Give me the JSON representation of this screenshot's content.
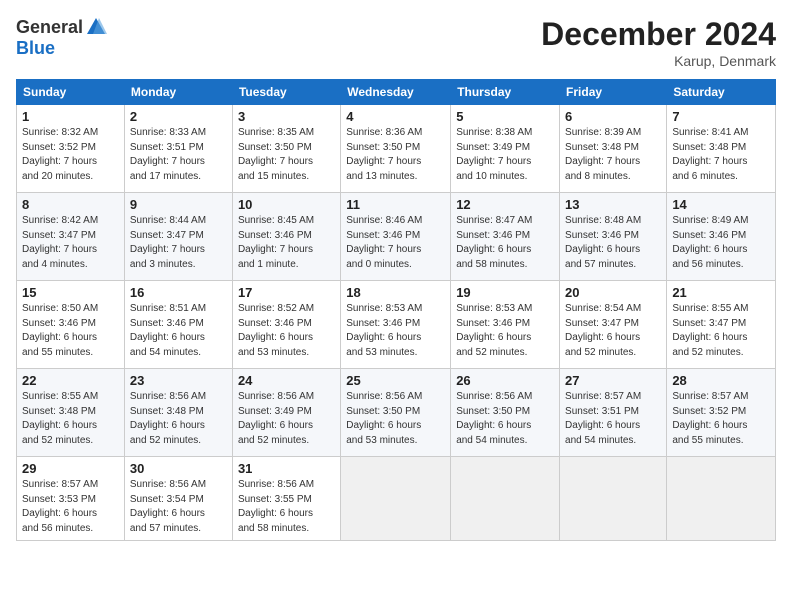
{
  "header": {
    "logo_general": "General",
    "logo_blue": "Blue",
    "month_title": "December 2024",
    "location": "Karup, Denmark"
  },
  "columns": [
    "Sunday",
    "Monday",
    "Tuesday",
    "Wednesday",
    "Thursday",
    "Friday",
    "Saturday"
  ],
  "weeks": [
    [
      {
        "day": "1",
        "info": "Sunrise: 8:32 AM\nSunset: 3:52 PM\nDaylight: 7 hours\nand 20 minutes."
      },
      {
        "day": "2",
        "info": "Sunrise: 8:33 AM\nSunset: 3:51 PM\nDaylight: 7 hours\nand 17 minutes."
      },
      {
        "day": "3",
        "info": "Sunrise: 8:35 AM\nSunset: 3:50 PM\nDaylight: 7 hours\nand 15 minutes."
      },
      {
        "day": "4",
        "info": "Sunrise: 8:36 AM\nSunset: 3:50 PM\nDaylight: 7 hours\nand 13 minutes."
      },
      {
        "day": "5",
        "info": "Sunrise: 8:38 AM\nSunset: 3:49 PM\nDaylight: 7 hours\nand 10 minutes."
      },
      {
        "day": "6",
        "info": "Sunrise: 8:39 AM\nSunset: 3:48 PM\nDaylight: 7 hours\nand 8 minutes."
      },
      {
        "day": "7",
        "info": "Sunrise: 8:41 AM\nSunset: 3:48 PM\nDaylight: 7 hours\nand 6 minutes."
      }
    ],
    [
      {
        "day": "8",
        "info": "Sunrise: 8:42 AM\nSunset: 3:47 PM\nDaylight: 7 hours\nand 4 minutes."
      },
      {
        "day": "9",
        "info": "Sunrise: 8:44 AM\nSunset: 3:47 PM\nDaylight: 7 hours\nand 3 minutes."
      },
      {
        "day": "10",
        "info": "Sunrise: 8:45 AM\nSunset: 3:46 PM\nDaylight: 7 hours\nand 1 minute."
      },
      {
        "day": "11",
        "info": "Sunrise: 8:46 AM\nSunset: 3:46 PM\nDaylight: 7 hours\nand 0 minutes."
      },
      {
        "day": "12",
        "info": "Sunrise: 8:47 AM\nSunset: 3:46 PM\nDaylight: 6 hours\nand 58 minutes."
      },
      {
        "day": "13",
        "info": "Sunrise: 8:48 AM\nSunset: 3:46 PM\nDaylight: 6 hours\nand 57 minutes."
      },
      {
        "day": "14",
        "info": "Sunrise: 8:49 AM\nSunset: 3:46 PM\nDaylight: 6 hours\nand 56 minutes."
      }
    ],
    [
      {
        "day": "15",
        "info": "Sunrise: 8:50 AM\nSunset: 3:46 PM\nDaylight: 6 hours\nand 55 minutes."
      },
      {
        "day": "16",
        "info": "Sunrise: 8:51 AM\nSunset: 3:46 PM\nDaylight: 6 hours\nand 54 minutes."
      },
      {
        "day": "17",
        "info": "Sunrise: 8:52 AM\nSunset: 3:46 PM\nDaylight: 6 hours\nand 53 minutes."
      },
      {
        "day": "18",
        "info": "Sunrise: 8:53 AM\nSunset: 3:46 PM\nDaylight: 6 hours\nand 53 minutes."
      },
      {
        "day": "19",
        "info": "Sunrise: 8:53 AM\nSunset: 3:46 PM\nDaylight: 6 hours\nand 52 minutes."
      },
      {
        "day": "20",
        "info": "Sunrise: 8:54 AM\nSunset: 3:47 PM\nDaylight: 6 hours\nand 52 minutes."
      },
      {
        "day": "21",
        "info": "Sunrise: 8:55 AM\nSunset: 3:47 PM\nDaylight: 6 hours\nand 52 minutes."
      }
    ],
    [
      {
        "day": "22",
        "info": "Sunrise: 8:55 AM\nSunset: 3:48 PM\nDaylight: 6 hours\nand 52 minutes."
      },
      {
        "day": "23",
        "info": "Sunrise: 8:56 AM\nSunset: 3:48 PM\nDaylight: 6 hours\nand 52 minutes."
      },
      {
        "day": "24",
        "info": "Sunrise: 8:56 AM\nSunset: 3:49 PM\nDaylight: 6 hours\nand 52 minutes."
      },
      {
        "day": "25",
        "info": "Sunrise: 8:56 AM\nSunset: 3:50 PM\nDaylight: 6 hours\nand 53 minutes."
      },
      {
        "day": "26",
        "info": "Sunrise: 8:56 AM\nSunset: 3:50 PM\nDaylight: 6 hours\nand 54 minutes."
      },
      {
        "day": "27",
        "info": "Sunrise: 8:57 AM\nSunset: 3:51 PM\nDaylight: 6 hours\nand 54 minutes."
      },
      {
        "day": "28",
        "info": "Sunrise: 8:57 AM\nSunset: 3:52 PM\nDaylight: 6 hours\nand 55 minutes."
      }
    ],
    [
      {
        "day": "29",
        "info": "Sunrise: 8:57 AM\nSunset: 3:53 PM\nDaylight: 6 hours\nand 56 minutes."
      },
      {
        "day": "30",
        "info": "Sunrise: 8:56 AM\nSunset: 3:54 PM\nDaylight: 6 hours\nand 57 minutes."
      },
      {
        "day": "31",
        "info": "Sunrise: 8:56 AM\nSunset: 3:55 PM\nDaylight: 6 hours\nand 58 minutes."
      },
      null,
      null,
      null,
      null
    ]
  ]
}
